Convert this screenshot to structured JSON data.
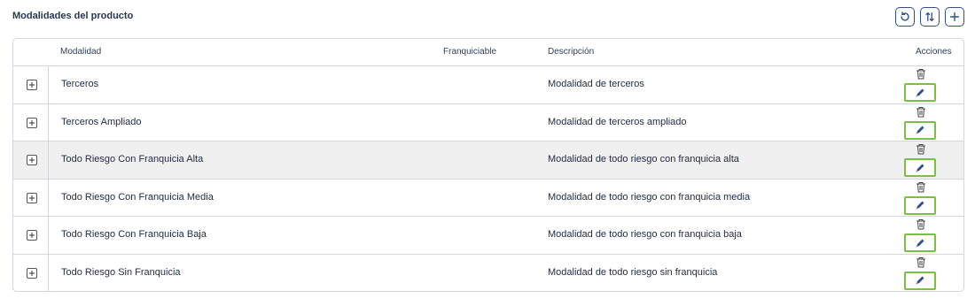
{
  "section": {
    "title": "Modalidades del producto"
  },
  "toolbar": {
    "buttons": [
      {
        "name": "refresh-button",
        "icon": "refresh-icon"
      },
      {
        "name": "sort-button",
        "icon": "sort-icon"
      },
      {
        "name": "add-button",
        "icon": "plus-icon"
      }
    ]
  },
  "table": {
    "headers": {
      "modalidad": "Modalidad",
      "franquiciable": "Franquiciable",
      "descripcion": "Descripción",
      "acciones": "Acciones"
    },
    "rows": [
      {
        "modalidad": "Terceros",
        "franquiciable": "",
        "descripcion": "Modalidad de terceros"
      },
      {
        "modalidad": "Terceros Ampliado",
        "franquiciable": "",
        "descripcion": "Modalidad de terceros ampliado"
      },
      {
        "modalidad": "Todo Riesgo Con Franquicia Alta",
        "franquiciable": "",
        "descripcion": "Modalidad de todo riesgo con franquicia alta",
        "highlighted": true
      },
      {
        "modalidad": "Todo Riesgo Con Franquicia Media",
        "franquiciable": "",
        "descripcion": "Modalidad de todo riesgo con franquicia media"
      },
      {
        "modalidad": "Todo Riesgo Con Franquicia Baja",
        "franquiciable": "",
        "descripcion": "Modalidad de todo riesgo con franquicia baja"
      },
      {
        "modalidad": "Todo Riesgo Sin Franquicia",
        "franquiciable": "",
        "descripcion": "Modalidad de todo riesgo sin franquicia"
      }
    ],
    "row_actions": [
      "trash-icon",
      "pencil-icon"
    ]
  },
  "colors": {
    "accent": "#2f4f8f",
    "edit_highlight": "#7ac143",
    "row_highlight": "#f0f0f0",
    "border": "#d2d6de"
  }
}
